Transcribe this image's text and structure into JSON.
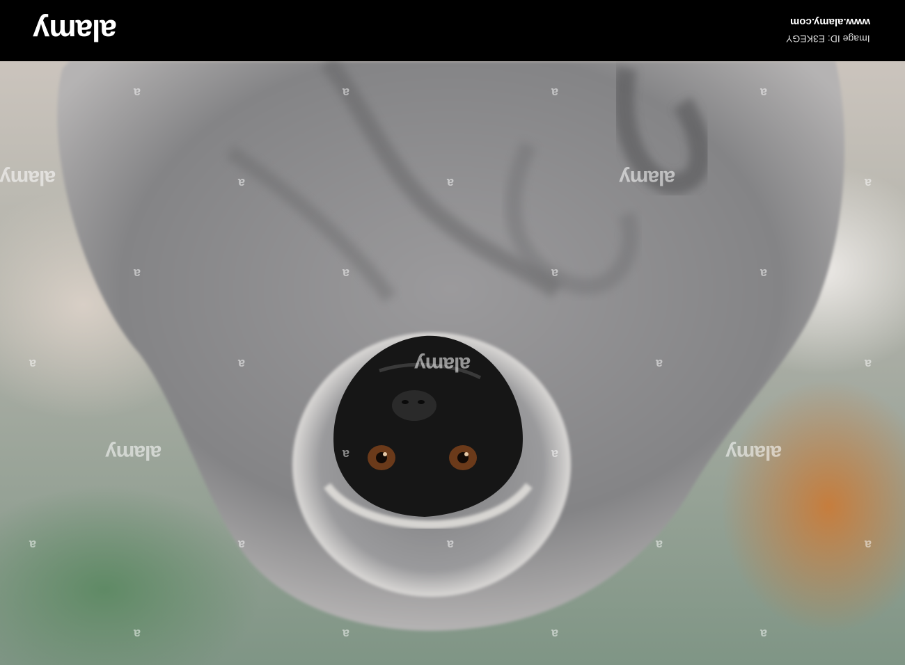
{
  "banner": {
    "brand": "alamy",
    "site": "www.alamy.com",
    "image_id": "Image ID: E3KEGY"
  },
  "watermark": {
    "word": "alamy",
    "letter": "a"
  },
  "photo": {
    "subject": "gibbon-upside-down",
    "colors": {
      "fur": "#8a8a8c",
      "face": "#141414",
      "eyes": "#6b3a1a",
      "banner": "#000000"
    }
  }
}
